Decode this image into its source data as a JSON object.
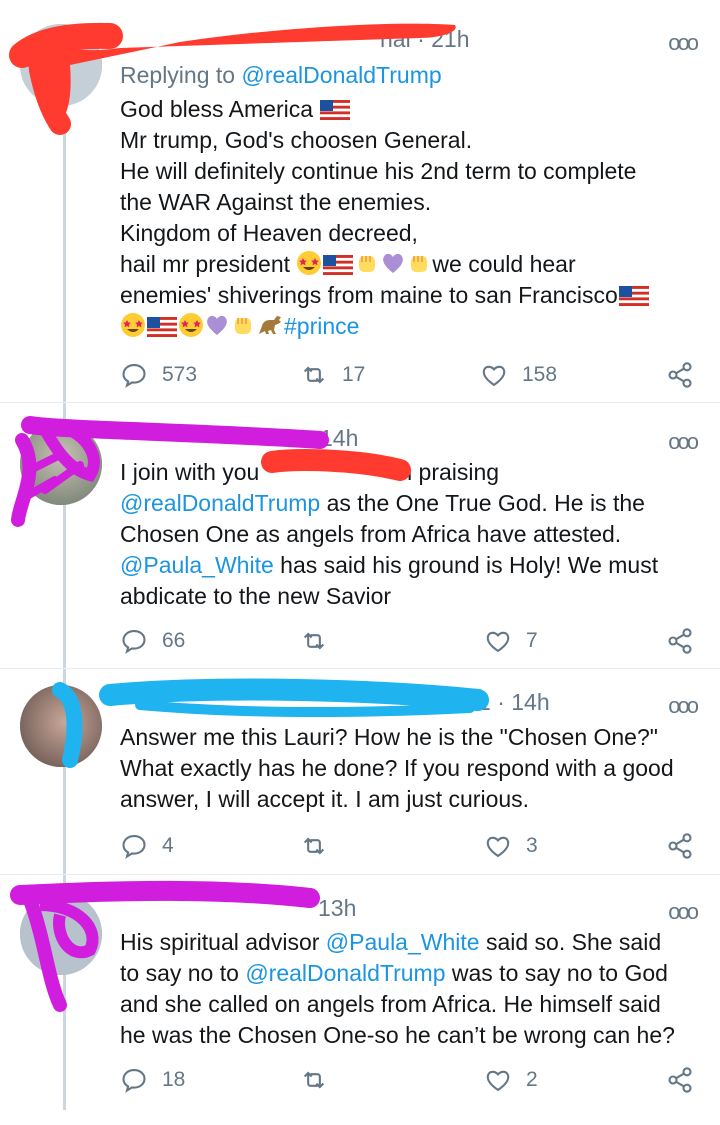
{
  "tweets": [
    {
      "name": "",
      "handle": "@ …nal",
      "time": "· 21h",
      "reply_to_prefix": "Replying to",
      "reply_to_handle": "@realDonaldTrump",
      "lines": [
        "God bless America",
        "Mr trump, God's choosen General.",
        "He will definitely continue his 2nd term to complete",
        "the WAR Against the enemies.",
        "Kingdom of Heaven decreed,",
        "hail mr president",
        "we could hear",
        "enemies' shiverings from maine to san Francisco",
        "#prince"
      ],
      "replies": "573",
      "retweets": "17",
      "likes": "158"
    },
    {
      "time": "14h",
      "text_a": "I join with you",
      "text_b": "n praising",
      "mention1": "@realDonaldTrump",
      "text_c": " as the One True God. He is the",
      "text_d": "Chosen One as angels from Africa have attested.",
      "mention2": "@Paula_White",
      "text_e": " has said his ground is Holy! We must",
      "text_f": "abdicate to the new Savior",
      "replies": "66",
      "retweets": "",
      "likes": "7"
    },
    {
      "handle_tail": "1",
      "time": "· 14h",
      "lines": [
        "Answer me this Lauri? How he is the \"Chosen One?\"",
        "What exactly has he done? If you respond with a good",
        "answer, I will accept it. I am just curious."
      ],
      "replies": "4",
      "retweets": "",
      "likes": "3"
    },
    {
      "time": "13h",
      "text_a": "His spiritual advisor ",
      "mention1": "@Paula_White",
      "text_b": " said so. She said",
      "text_c": "to say no to ",
      "mention2": "@realDonaldTrump",
      "text_d": " was to say no to God",
      "text_e": "and she called on angels from Africa. He himself said",
      "text_f": "he was the Chosen One-so he can’t be wrong can he?",
      "replies": "18",
      "retweets": "",
      "likes": "2"
    }
  ],
  "colors": {
    "link": "#1b95e0",
    "muted": "#657786",
    "red_scribble": "#ff3b2f",
    "magenta_scribble": "#d11dde",
    "blue_scribble": "#1fb3f0"
  },
  "icons": [
    "reply-icon",
    "retweet-icon",
    "like-icon",
    "share-icon",
    "more-icon",
    "us-flag-icon",
    "star-struck-icon",
    "raised-fist-icon",
    "purple-heart-icon",
    "dinosaur-icon"
  ]
}
